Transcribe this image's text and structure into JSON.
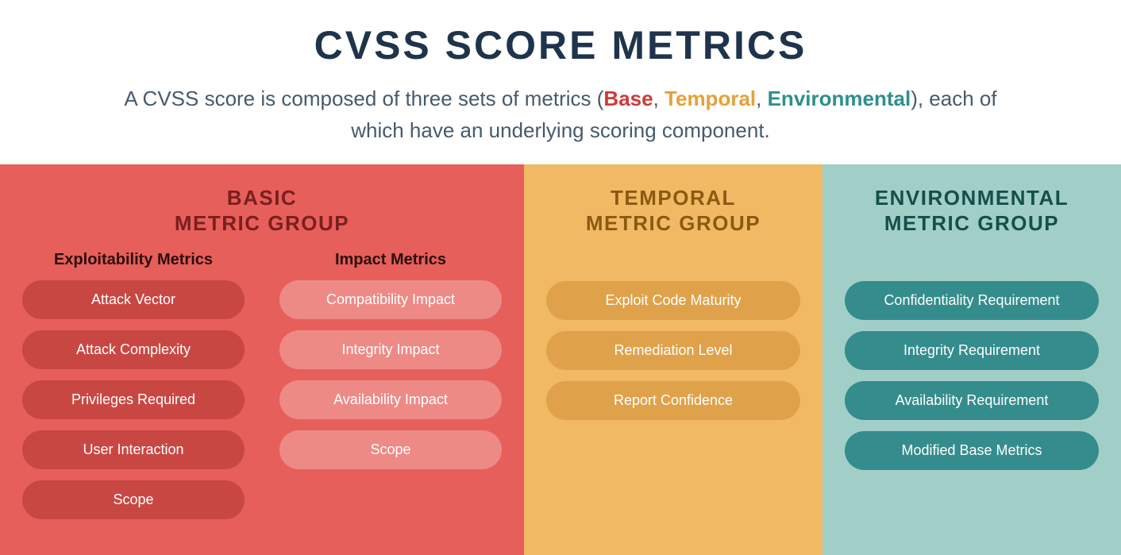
{
  "header": {
    "title": "CVSS SCORE METRICS",
    "subtitle_prefix": "A CVSS score is composed of three sets of metrics (",
    "accent_base": "Base",
    "sep1": ", ",
    "accent_temporal": "Temporal",
    "sep2": ", ",
    "accent_env": "Environmental",
    "subtitle_suffix": "), each of which have an underlying scoring component."
  },
  "groups": {
    "basic": {
      "title_line1": "BASIC",
      "title_line2": "METRIC GROUP",
      "sub_exploit": {
        "title": "Exploitability Metrics",
        "items": [
          "Attack Vector",
          "Attack Complexity",
          "Privileges Required",
          "User Interaction",
          "Scope"
        ]
      },
      "sub_impact": {
        "title": "Impact Metrics",
        "items": [
          "Compatibility Impact",
          "Integrity Impact",
          "Availability Impact",
          "Scope"
        ]
      }
    },
    "temporal": {
      "title_line1": "TEMPORAL",
      "title_line2": "METRIC GROUP",
      "items": [
        "Exploit Code Maturity",
        "Remediation Level",
        "Report Confidence"
      ]
    },
    "environmental": {
      "title_line1": "ENVIRONMENTAL",
      "title_line2": "METRIC GROUP",
      "items": [
        "Confidentiality Requirement",
        "Integrity Requirement",
        "Availability Requirement",
        "Modified Base Metrics"
      ]
    }
  }
}
